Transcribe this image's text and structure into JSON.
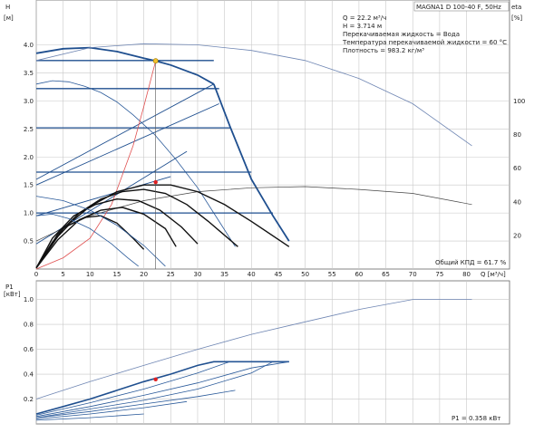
{
  "chart_data": [
    {
      "type": "line",
      "title": "MAGNA1 D 100-40 F, 50Hz",
      "info_lines": [
        "Q = 22.2 м³/ч",
        "H = 3.714 м",
        "Перекачиваемая жидкость = Вода",
        "Температура перекачиваемой жидкости = 60 °C",
        "Плотность = 983.2 кг/м³"
      ],
      "ylabel_left": "H",
      "ylabel_left_unit": "[м]",
      "ylabel_right": "eta",
      "ylabel_right_unit": "[%]",
      "xlabel": "Q [м³/ч]",
      "x_ticks": [
        "0",
        "5",
        "10",
        "15",
        "20",
        "25",
        "30",
        "35",
        "40",
        "45",
        "50",
        "55",
        "60",
        "65",
        "70",
        "75",
        "80"
      ],
      "y_ticks_left": [
        "0.5",
        "1.0",
        "1.5",
        "2.0",
        "2.5",
        "3.0",
        "3.5",
        "4.0"
      ],
      "y_ticks_right": [
        "20",
        "40",
        "60",
        "80",
        "100"
      ],
      "xlim": [
        0,
        88
      ],
      "ylim": [
        0,
        4.8
      ],
      "eta_lim": [
        0,
        160
      ],
      "efficiency_note": "Общий КПД = 61.7 %",
      "duty_point": {
        "q": 22.2,
        "h": 3.714
      },
      "eta_point": {
        "q": 22.2,
        "h": 1.55
      },
      "series": [
        {
          "role": "head-max",
          "x": [
            0,
            5,
            10,
            15,
            20,
            22.2,
            25,
            30,
            33
          ],
          "y": [
            3.85,
            3.93,
            3.95,
            3.88,
            3.76,
            3.714,
            3.64,
            3.46,
            3.3
          ]
        },
        {
          "role": "head-limit",
          "x": [
            33,
            36,
            40,
            44,
            47
          ],
          "y": [
            3.3,
            2.55,
            1.6,
            0.95,
            0.5
          ]
        },
        {
          "role": "head-curve",
          "x": [
            0,
            3,
            6,
            9,
            12,
            15,
            18,
            22,
            26,
            30,
            34,
            37
          ],
          "y": [
            3.3,
            3.36,
            3.34,
            3.26,
            3.15,
            2.98,
            2.75,
            2.4,
            1.95,
            1.45,
            0.85,
            0.4
          ]
        },
        {
          "role": "prop-pressure",
          "x": [
            0,
            33
          ],
          "y": [
            1.6,
            3.3
          ]
        },
        {
          "role": "prop-pressure",
          "x": [
            0,
            34
          ],
          "y": [
            1.5,
            2.95
          ]
        },
        {
          "role": "prop-pressure",
          "x": [
            0,
            28
          ],
          "y": [
            0.45,
            2.1
          ]
        },
        {
          "role": "prop-pressure",
          "x": [
            0,
            25
          ],
          "y": [
            0.95,
            1.65
          ]
        },
        {
          "role": "setpoint",
          "x": [
            0,
            5,
            10,
            15,
            20,
            25,
            30,
            33
          ],
          "y": [
            3.72,
            3.72,
            3.72,
            3.72,
            3.72,
            3.72,
            3.72,
            3.72
          ]
        },
        {
          "role": "setpoint",
          "x": [
            0,
            5,
            10,
            15,
            20,
            25,
            30,
            34
          ],
          "y": [
            3.22,
            3.22,
            3.22,
            3.22,
            3.22,
            3.22,
            3.22,
            3.22
          ]
        },
        {
          "role": "setpoint",
          "x": [
            0,
            10,
            20,
            30,
            36
          ],
          "y": [
            2.52,
            2.52,
            2.52,
            2.52,
            2.52
          ]
        },
        {
          "role": "setpoint",
          "x": [
            0,
            10,
            20,
            30,
            40
          ],
          "y": [
            1.73,
            1.73,
            1.73,
            1.73,
            1.73
          ]
        },
        {
          "role": "setpoint",
          "x": [
            0,
            10,
            20,
            30,
            44
          ],
          "y": [
            1.0,
            1.0,
            1.0,
            1.0,
            1.0
          ]
        },
        {
          "role": "system-curve",
          "x": [
            0,
            5,
            10,
            14,
            18,
            20,
            22.2
          ],
          "y": [
            0,
            0.2,
            0.55,
            1.15,
            2.2,
            2.9,
            3.714
          ]
        },
        {
          "role": "eta-max",
          "x": [
            0,
            10,
            20,
            30,
            40,
            50,
            60,
            70,
            81
          ],
          "y": [
            3.72,
            3.95,
            4.02,
            4.0,
            3.9,
            3.72,
            3.4,
            2.95,
            2.2
          ]
        },
        {
          "role": "eta-curve",
          "x": [
            0,
            10,
            20,
            30,
            40,
            50,
            60,
            70,
            81
          ],
          "y": [
            0.5,
            0.95,
            1.22,
            1.38,
            1.45,
            1.47,
            1.42,
            1.35,
            1.15
          ]
        },
        {
          "role": "eta-bold",
          "x": [
            0,
            5,
            10,
            15,
            20,
            25,
            30,
            35,
            40,
            47
          ],
          "y": [
            0.02,
            0.72,
            1.12,
            1.38,
            1.5,
            1.5,
            1.38,
            1.15,
            0.85,
            0.4
          ]
        },
        {
          "role": "eta-bold",
          "x": [
            0,
            4,
            8,
            12,
            16,
            20,
            24,
            28,
            32,
            37.5
          ],
          "y": [
            0.02,
            0.62,
            1.0,
            1.25,
            1.38,
            1.42,
            1.35,
            1.15,
            0.85,
            0.4
          ]
        },
        {
          "role": "eta-bold",
          "x": [
            0,
            3,
            7,
            11,
            15,
            19,
            23,
            27,
            30
          ],
          "y": [
            0.02,
            0.55,
            0.95,
            1.15,
            1.25,
            1.22,
            1.05,
            0.75,
            0.45
          ]
        },
        {
          "role": "eta-bold",
          "x": [
            0,
            4,
            8,
            12,
            16,
            20,
            24,
            26
          ],
          "y": [
            0.02,
            0.52,
            0.88,
            1.05,
            1.1,
            0.98,
            0.72,
            0.4
          ]
        },
        {
          "role": "eta-bold",
          "x": [
            0,
            3,
            6,
            9,
            12,
            15,
            18,
            20
          ],
          "y": [
            0.02,
            0.48,
            0.78,
            0.92,
            0.95,
            0.82,
            0.55,
            0.35
          ]
        },
        {
          "role": "small-curve",
          "x": [
            0,
            3,
            6,
            10,
            14,
            17,
            19
          ],
          "y": [
            0.95,
            0.98,
            0.9,
            0.72,
            0.45,
            0.2,
            0.05
          ]
        },
        {
          "role": "small-curve",
          "x": [
            0,
            5,
            10,
            15,
            20,
            24
          ],
          "y": [
            1.3,
            1.22,
            1.05,
            0.78,
            0.42,
            0.05
          ]
        }
      ]
    },
    {
      "type": "line",
      "ylabel": "P1",
      "ylabel_unit": "[кВт]",
      "y_ticks": [
        "0.2",
        "0.4",
        "0.6",
        "0.8",
        "1.0"
      ],
      "xlim": [
        0,
        88
      ],
      "ylim": [
        0,
        1.15
      ],
      "power_note": "P1 = 0.358 кВт",
      "operating_point": {
        "q": 22.2,
        "p": 0.358
      },
      "series": [
        {
          "role": "power-max",
          "x": [
            0,
            10,
            20,
            30,
            40,
            50,
            60,
            70,
            81
          ],
          "y": [
            0.2,
            0.34,
            0.47,
            0.6,
            0.72,
            0.82,
            0.92,
            1.0,
            1.0
          ]
        },
        {
          "role": "power-bold",
          "x": [
            0,
            5,
            10,
            15,
            20,
            25,
            30,
            33,
            47
          ],
          "y": [
            0.08,
            0.14,
            0.2,
            0.27,
            0.34,
            0.4,
            0.47,
            0.5,
            0.5
          ]
        },
        {
          "role": "power-curve",
          "x": [
            0,
            10,
            20,
            30,
            36,
            47
          ],
          "y": [
            0.07,
            0.17,
            0.28,
            0.41,
            0.5,
            0.5
          ]
        },
        {
          "role": "power-curve",
          "x": [
            0,
            10,
            20,
            30,
            40,
            47
          ],
          "y": [
            0.06,
            0.14,
            0.23,
            0.33,
            0.45,
            0.5
          ]
        },
        {
          "role": "power-curve",
          "x": [
            0,
            10,
            20,
            30,
            40,
            44
          ],
          "y": [
            0.05,
            0.12,
            0.19,
            0.28,
            0.41,
            0.5
          ]
        },
        {
          "role": "power-curve",
          "x": [
            0,
            10,
            20,
            30,
            37
          ],
          "y": [
            0.05,
            0.1,
            0.16,
            0.22,
            0.27
          ]
        },
        {
          "role": "power-curve",
          "x": [
            0,
            10,
            20,
            28
          ],
          "y": [
            0.04,
            0.08,
            0.13,
            0.18
          ]
        },
        {
          "role": "power-curve",
          "x": [
            0,
            10,
            20
          ],
          "y": [
            0.03,
            0.05,
            0.08
          ]
        }
      ]
    }
  ]
}
